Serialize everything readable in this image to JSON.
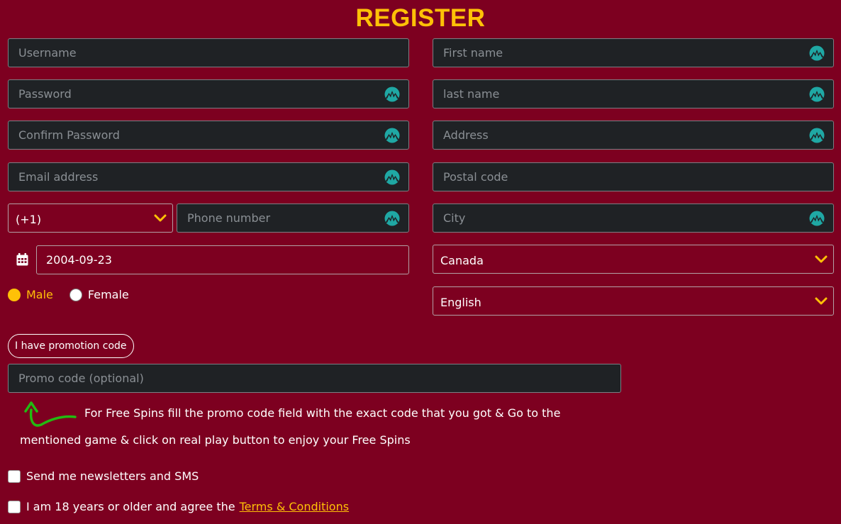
{
  "title": "REGISTER",
  "fields": {
    "username": "Username",
    "password": "Password",
    "confirm_password": "Confirm Password",
    "email": "Email address",
    "phone": "Phone number",
    "first_name": "First name",
    "last_name": "last name",
    "address": "Address",
    "postal_code": "Postal code",
    "city": "City",
    "promo_code": "Promo code (optional)"
  },
  "phone_code": "(+1)",
  "birth_date": "2004-09-23",
  "country": "Canada",
  "language": "English",
  "gender": {
    "male_label": "Male",
    "female_label": "Female",
    "selected": "Male"
  },
  "promo_button": "I have promotion code",
  "free_spins_info": {
    "line1": "For Free Spins fill the promo code field with the exact code that you got & Go to the",
    "line2": "mentioned game & click on real play button to enjoy your Free Spins"
  },
  "newsletter_label": "Send me newsletters and SMS",
  "terms_text": "I am 18 years or older and agree the",
  "terms_link": "Terms & Conditions",
  "colors": {
    "background": "#7d0020",
    "accent": "#ffc107",
    "field_bg": "#1f2225",
    "icon_teal": "#1fa8a4",
    "arrow_green": "#22bb11"
  },
  "icons": {
    "password_manager": "password-manager-icon",
    "calendar": "calendar-icon",
    "chevron": "chevron-down-icon",
    "arrow": "curved-arrow-up-icon"
  }
}
